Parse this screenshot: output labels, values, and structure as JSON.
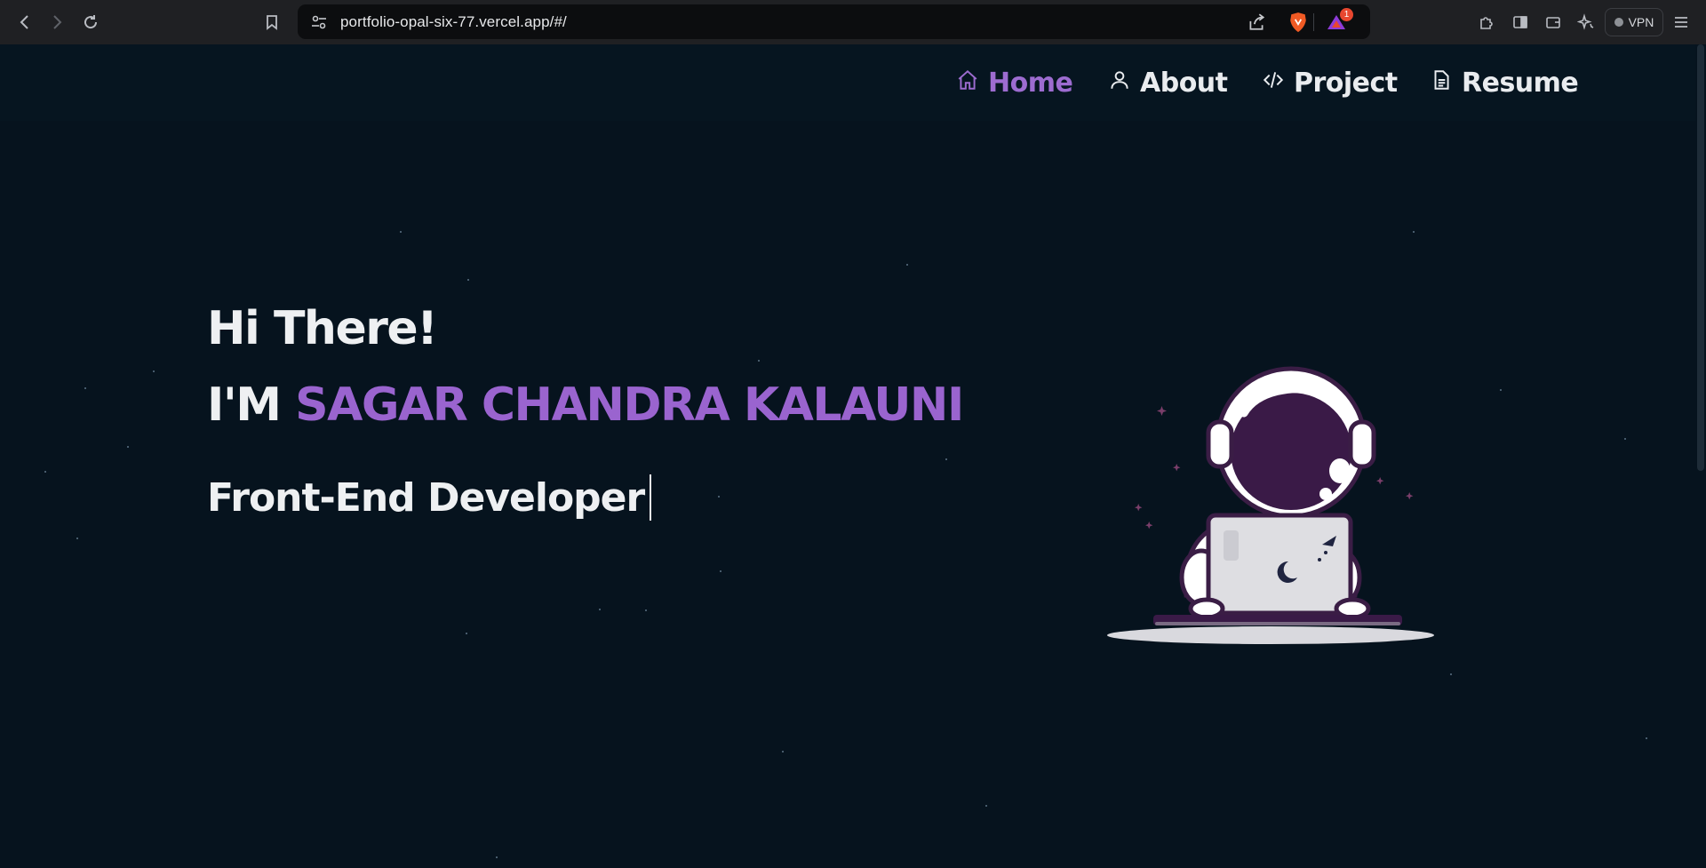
{
  "browser": {
    "url": "portfolio-opal-six-77.vercel.app/#/",
    "notification_count": "1",
    "vpn_label": "VPN"
  },
  "nav": {
    "items": [
      {
        "label": "Home",
        "icon": "home-icon",
        "active": true
      },
      {
        "label": "About",
        "icon": "user-icon",
        "active": false
      },
      {
        "label": "Project",
        "icon": "code-icon",
        "active": false
      },
      {
        "label": "Resume",
        "icon": "document-icon",
        "active": false
      }
    ]
  },
  "hero": {
    "greeting": "Hi There!",
    "intro_prefix": "I'M",
    "name": "SAGAR CHANDRA KALAUNI",
    "role": "Front-End Developer"
  },
  "colors": {
    "accent": "#9a64cf",
    "background": "#06131e",
    "text": "#eef0f2"
  }
}
